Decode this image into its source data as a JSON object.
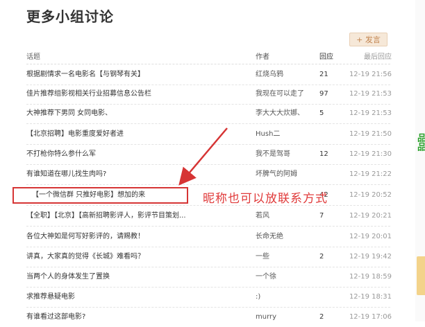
{
  "page": {
    "title": "更多小组讨论",
    "post_button": "+ 发言"
  },
  "table": {
    "headers": {
      "topic": "话题",
      "author": "作者",
      "replies": "回应",
      "last_reply": "最后回应"
    },
    "rows": [
      {
        "topic": "根据剧情求一名电影名【与钢琴有关】",
        "author": "红烧乌鸦",
        "replies": "21",
        "last": "12-19 21:56"
      },
      {
        "topic": "佳片推荐组影视相关行业招募信息公告栏",
        "author": "我现在可以走了",
        "replies": "97",
        "last": "12-19 21:53"
      },
      {
        "topic": "大神推荐下男同 女同电影、",
        "author": "李大大大炊娜、",
        "replies": "5",
        "last": "12-19 21:53"
      },
      {
        "topic": "【北京招聘】电影重度爱好者进",
        "author": "Hush二",
        "replies": "",
        "last": "12-19 21:50"
      },
      {
        "topic": "不打枪你特么参什么军",
        "author": "我不是驾哥",
        "replies": "12",
        "last": "12-19 21:30"
      },
      {
        "topic": "有谁知道在哪儿找生肉吗?",
        "author": "坏脾气的阿姆",
        "replies": "",
        "last": "12-19 21:22"
      },
      {
        "topic": "【一个微信群 只推好电影】想加的来",
        "author": "",
        "replies": "42",
        "last": "12-19 20:52"
      },
      {
        "topic": "【全职】【北京】【高新招聘影评人，影评节目策划...",
        "author": "若风",
        "replies": "7",
        "last": "12-19 20:21"
      },
      {
        "topic": "各位大神如是何写好影评的，请赐教！",
        "author": "长命无绝",
        "replies": "",
        "last": "12-19 20:01"
      },
      {
        "topic": "讲真，大家真的觉得《长城》难看吗？",
        "author": "一些",
        "replies": "2",
        "last": "12-19 19:42"
      },
      {
        "topic": "当两个人的身体发生了置换",
        "author": "一个徐",
        "replies": "",
        "last": "12-19 18:59"
      },
      {
        "topic": "求推荐悬疑电影",
        "author": ":)",
        "replies": "",
        "last": "12-19 18:31"
      },
      {
        "topic": "有谁看过这部电影?",
        "author": "murry",
        "replies": "2",
        "last": "12-19 17:06"
      }
    ]
  },
  "annotation": {
    "text": "昵称也可以放联系方式",
    "color": "#e03a3a"
  },
  "side": {
    "green_text": "品品"
  }
}
